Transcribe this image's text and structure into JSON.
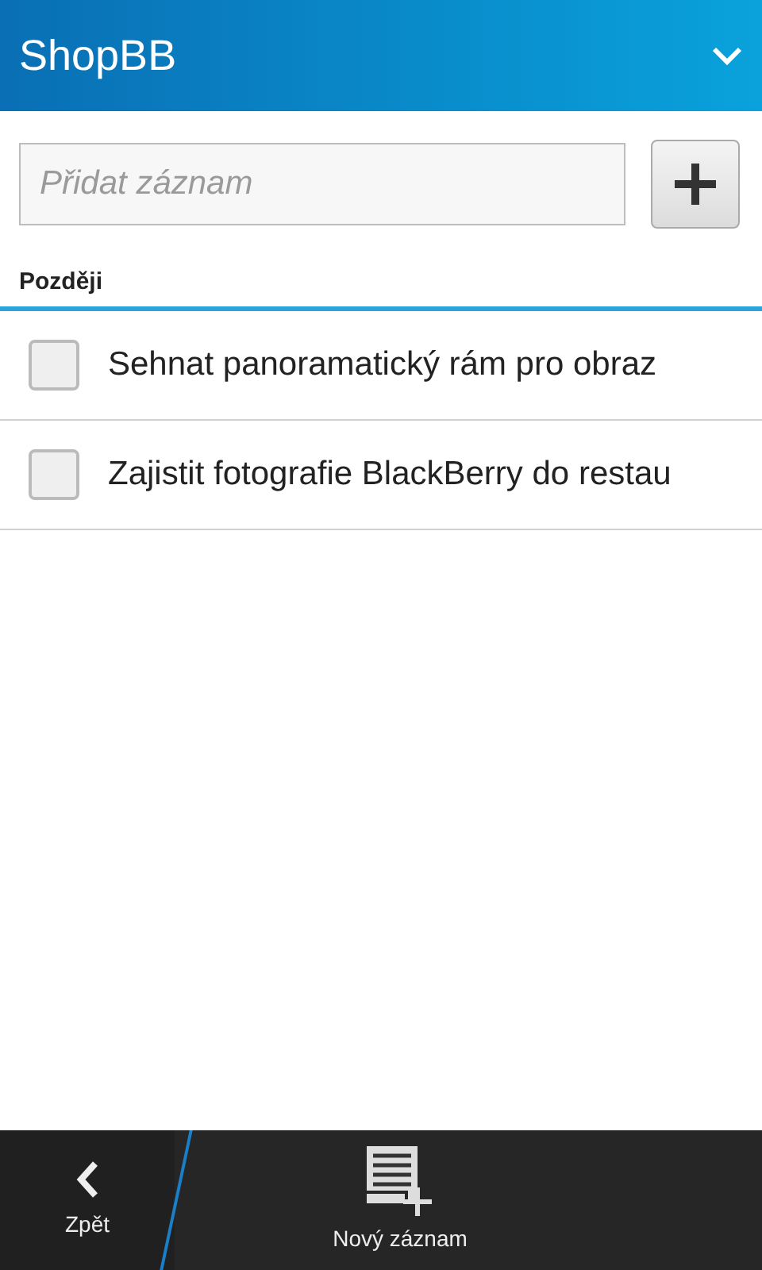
{
  "title_bar": {
    "title": "ShopBB"
  },
  "add_field": {
    "placeholder": "Přidat záznam"
  },
  "section": {
    "title": "Později"
  },
  "items": [
    {
      "text": "Sehnat panoramatický rám pro obraz",
      "checked": false
    },
    {
      "text": "Zajistit fotografie BlackBerry do restau",
      "checked": false
    }
  ],
  "action_bar": [
    {
      "kind": "back",
      "label": "Zpět"
    },
    {
      "kind": "new",
      "label": "Nový záznam"
    }
  ]
}
